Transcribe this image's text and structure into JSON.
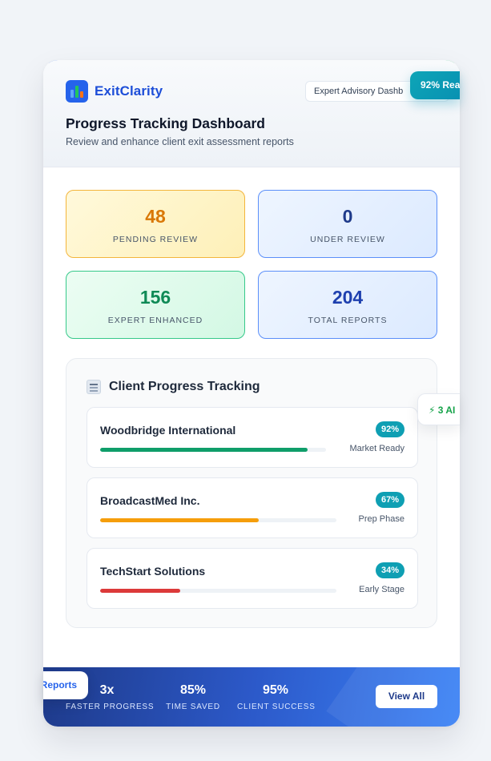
{
  "brand": {
    "name": "ExitClarity",
    "logo_icon": "bar-chart-icon"
  },
  "header": {
    "advisory_label": "Expert Advisory Dashb",
    "title": "Progress Tracking Dashboard",
    "subtitle": "Review and enhance client exit assessment reports"
  },
  "stats": [
    {
      "value": "48",
      "label": "PENDING REVIEW",
      "color": "#d97706"
    },
    {
      "value": "0",
      "label": "UNDER REVIEW",
      "color": "#1e3a8a"
    },
    {
      "value": "156",
      "label": "EXPERT ENHANCED",
      "color": "#0f8a56"
    },
    {
      "value": "204",
      "label": "TOTAL REPORTS",
      "color": "#1e40af"
    }
  ],
  "tracking": {
    "icon": "clipboard-icon",
    "title": "Client Progress Tracking",
    "clients": [
      {
        "name": "Woodbridge International",
        "percent_label": "92%",
        "progress": 0.92,
        "phase": "Market Ready",
        "bar_color": "#0f9e6a"
      },
      {
        "name": "BroadcastMed Inc.",
        "percent_label": "67%",
        "progress": 0.67,
        "phase": "Prep Phase",
        "bar_color": "#f59e0b"
      },
      {
        "name": "TechStart Solutions",
        "percent_label": "34%",
        "progress": 0.34,
        "phase": "Early Stage",
        "bar_color": "#dc3a3a"
      }
    ]
  },
  "footer": {
    "stats": [
      {
        "value": "3x",
        "label": "FASTER PROGRESS"
      },
      {
        "value": "85%",
        "label": "TIME SAVED"
      },
      {
        "value": "95%",
        "label": "CLIENT SUCCESS"
      }
    ],
    "view_all_label": "View All"
  },
  "floating": {
    "ready_badge": "92% Rea",
    "ai_badge": "⚡ 3 AI",
    "reports_badge": "Reports"
  },
  "colors": {
    "accent": "#2563eb",
    "teal": "#0e9fb3",
    "footer_start": "#1e3a8a",
    "footer_end": "#3b82f6"
  }
}
